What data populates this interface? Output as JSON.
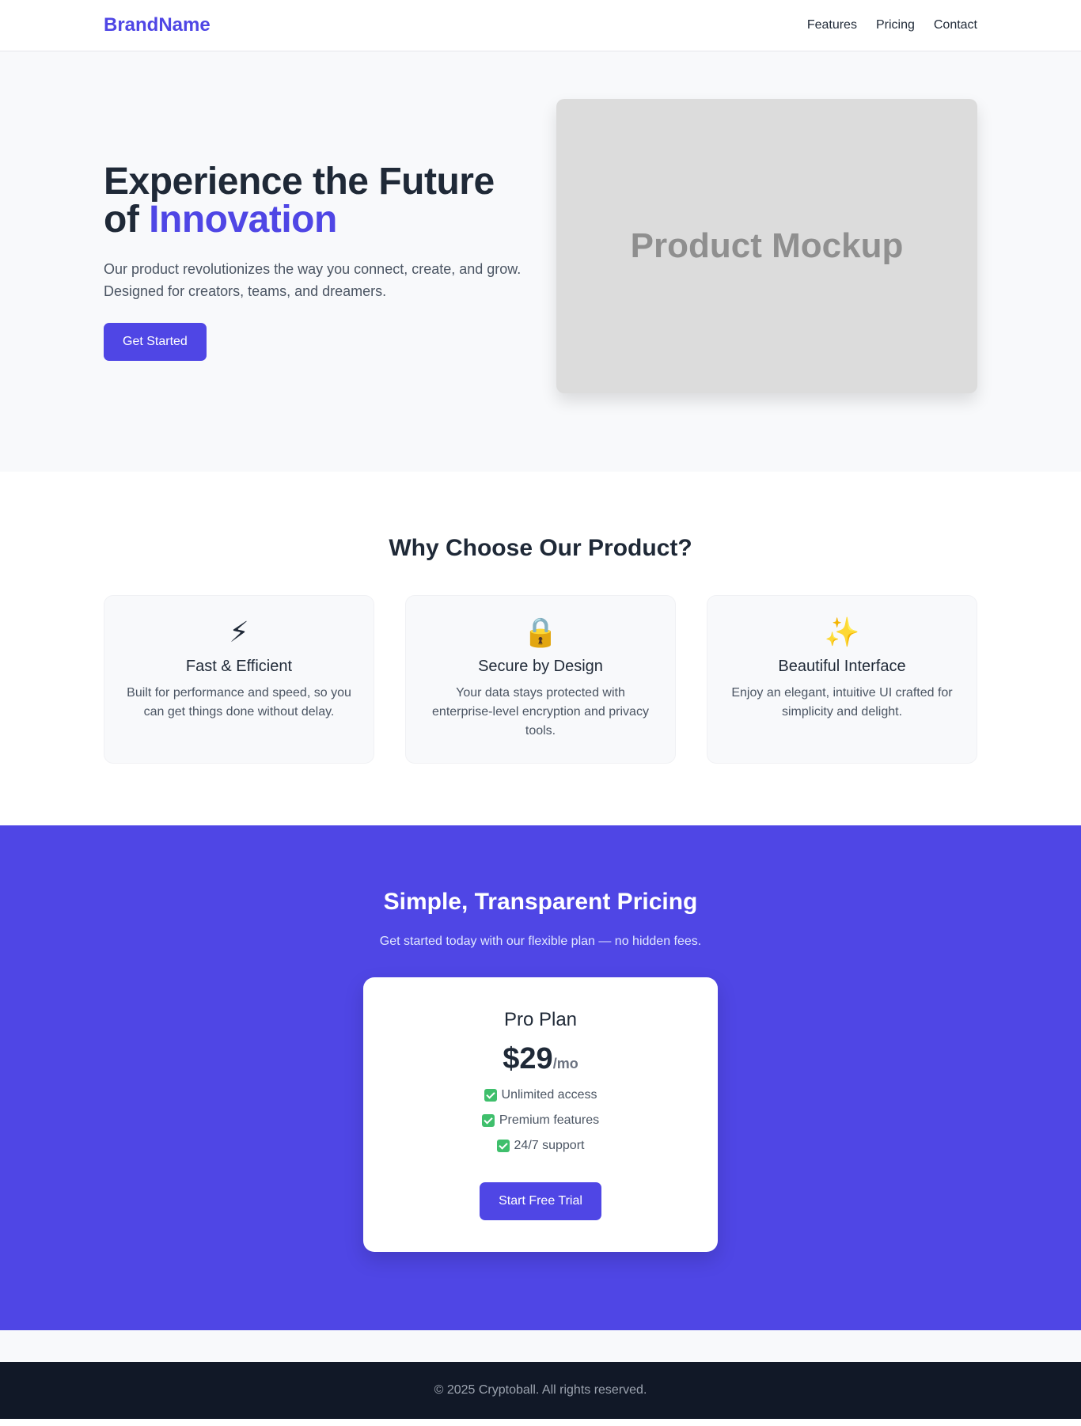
{
  "header": {
    "brand": "BrandName",
    "nav": [
      {
        "label": "Features"
      },
      {
        "label": "Pricing"
      },
      {
        "label": "Contact"
      }
    ]
  },
  "hero": {
    "title_line1": "Experience the Future",
    "title_of": "of",
    "title_accent": "Innovation",
    "description": "Our product revolutionizes the way you connect, create, and grow. Designed for creators, teams, and dreamers.",
    "cta_label": "Get Started",
    "mockup_label": "Product Mockup"
  },
  "features": {
    "title": "Why Choose Our Product?",
    "cards": [
      {
        "icon": "lightning-icon",
        "glyph": "⚡",
        "title": "Fast & Efficient",
        "description": "Built for performance and speed, so you can get things done without delay."
      },
      {
        "icon": "lock-icon",
        "glyph": "🔒",
        "title": "Secure by Design",
        "description": "Your data stays protected with enterprise-level encryption and privacy tools."
      },
      {
        "icon": "sparkles-icon",
        "glyph": "✨",
        "title": "Beautiful Interface",
        "description": "Enjoy an elegant, intuitive UI crafted for simplicity and delight."
      }
    ]
  },
  "pricing": {
    "title": "Simple, Transparent Pricing",
    "subtitle": "Get started today with our flexible plan — no hidden fees.",
    "plan": {
      "name": "Pro Plan",
      "price": "$29",
      "period": "/mo",
      "features": [
        "Unlimited access",
        "Premium features",
        "24/7 support"
      ],
      "cta_label": "Start Free Trial"
    }
  },
  "footer": {
    "text": "© 2025 Cryptoball. All rights reserved."
  },
  "colors": {
    "accent": "#4f46e5",
    "footer_bg": "#111827",
    "hero_bg": "#f8f9fb",
    "check": "#3fbf6c"
  }
}
